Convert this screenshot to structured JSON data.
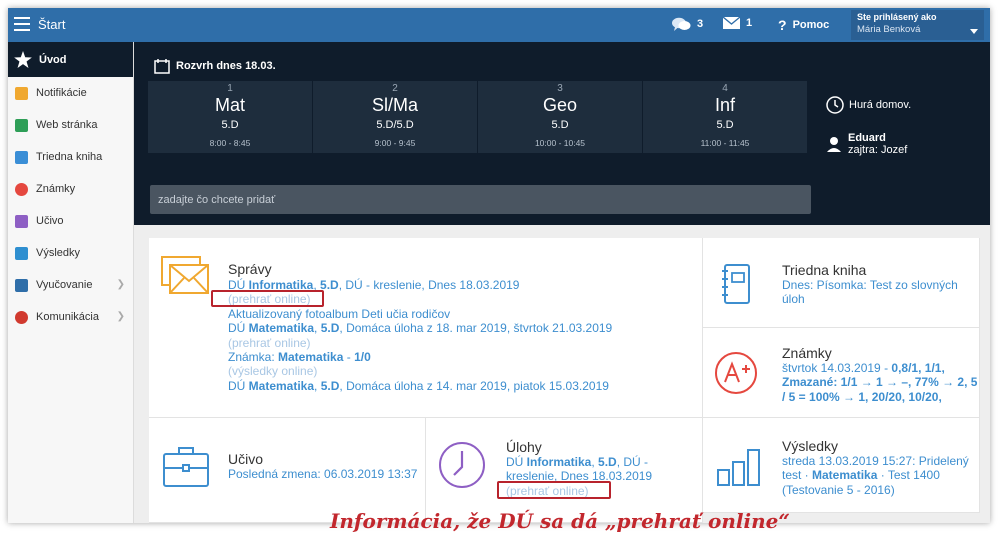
{
  "topbar": {
    "title": "Štart",
    "messages_count": "3",
    "mail_count": "1",
    "help_label": "Pomoc",
    "logged_label": "Ste prihlásený ako",
    "user_name": "Mária Benková"
  },
  "sidebar": {
    "home": "Úvod",
    "items": [
      {
        "label": "Notifikácie",
        "color": "#f0a830"
      },
      {
        "label": "Web stránka",
        "color": "#2e9e57"
      },
      {
        "label": "Triedna kniha",
        "color": "#3a8ed6"
      },
      {
        "label": "Známky",
        "color": "#e5483f"
      },
      {
        "label": "Učivo",
        "color": "#8e5fc4"
      },
      {
        "label": "Výsledky",
        "color": "#2f8fd0"
      },
      {
        "label": "Vyučovanie",
        "color": "#2f6ea9"
      },
      {
        "label": "Komunikácia",
        "color": "#d13a2f"
      }
    ]
  },
  "timetable": {
    "title": "Rozvrh dnes 18.03.",
    "lessons": [
      {
        "num": "1",
        "subject": "Mat",
        "class": "5.D",
        "time": "8:00 - 8:45"
      },
      {
        "num": "2",
        "subject": "Sl/Ma",
        "class": "5.D/5.D",
        "time": "9:00 - 9:45"
      },
      {
        "num": "3",
        "subject": "Geo",
        "class": "5.D",
        "time": "10:00 - 10:45"
      },
      {
        "num": "4",
        "subject": "Inf",
        "class": "5.D",
        "time": "11:00 - 11:45"
      }
    ],
    "status": "Hurá domov.",
    "birthday_name": "Eduard",
    "birthday_tomorrow": "zajtra: Jozef",
    "add_placeholder": "zadajte čo chcete pridať"
  },
  "spravy": {
    "title": "Správy",
    "e1_prefix": "DÚ ",
    "e1_subject": "Informatika",
    "e1_sep": ", ",
    "e1_class": "5.D",
    "e1_rest": ", DÚ - kreslenie, Dnes 18.03.2019",
    "e1_online": "(prehrať online)",
    "e2": "Aktualizovaný fotoalbum Deti učia rodičov",
    "e3_prefix": "DÚ ",
    "e3_subject": "Matematika",
    "e3_sep": ", ",
    "e3_class": "5.D",
    "e3_rest": ", Domáca úloha z 18. mar 2019, štvrtok 21.03.2019",
    "e3_online": "(prehrať online)",
    "e4_prefix": "Známka: ",
    "e4_subject": "Matematika",
    "e4_sep": " - ",
    "e4_grade": "1/0",
    "e4_online": "(výsledky online)",
    "e5_prefix": "DÚ ",
    "e5_subject": "Matematika",
    "e5_sep": ", ",
    "e5_class": "5.D",
    "e5_rest": ", Domáca úloha z 14. mar 2019, piatok 15.03.2019"
  },
  "triedna": {
    "title": "Triedna kniha",
    "text": "Dnes: Písomka: Test zo slovných úloh"
  },
  "znamky": {
    "title": "Známky",
    "l1_date": "štvrtok 14.03.2019 - ",
    "l1_vals": "0,8/1, 1/1,",
    "l2": "Zmazané: 1/1 → 1 → –, 77% → 2, 5",
    "l3": "/ 5 = 100% → 1, 20/20, 10/20,"
  },
  "ucivo": {
    "title": "Učivo",
    "text": "Posledná zmena: 06.03.2019 13:37"
  },
  "ulohy": {
    "title": "Úlohy",
    "l1_prefix": "DÚ ",
    "l1_subject": "Informatika",
    "l1_sep": ", ",
    "l1_class": "5.D",
    "l1_rest": ", DÚ -",
    "l2": "kreslenie, Dnes 18.03.2019",
    "online": "(prehrať online)"
  },
  "vysledky": {
    "title": "Výsledky",
    "l1": "streda 13.03.2019 15:27: Pridelený",
    "l2_prefix": "test · ",
    "l2_subject": "Matematika",
    "l2_rest": " · Test 1400",
    "l3": "(Testovanie 5 - 2016)"
  },
  "annotation": "Informácia, že DÚ sa dá „prehrať online“",
  "colors": {
    "topbar": "#2f6ea9",
    "dark_panel": "#0f1c2b",
    "link": "#3d8ecf",
    "highlight": "#b8232c"
  }
}
